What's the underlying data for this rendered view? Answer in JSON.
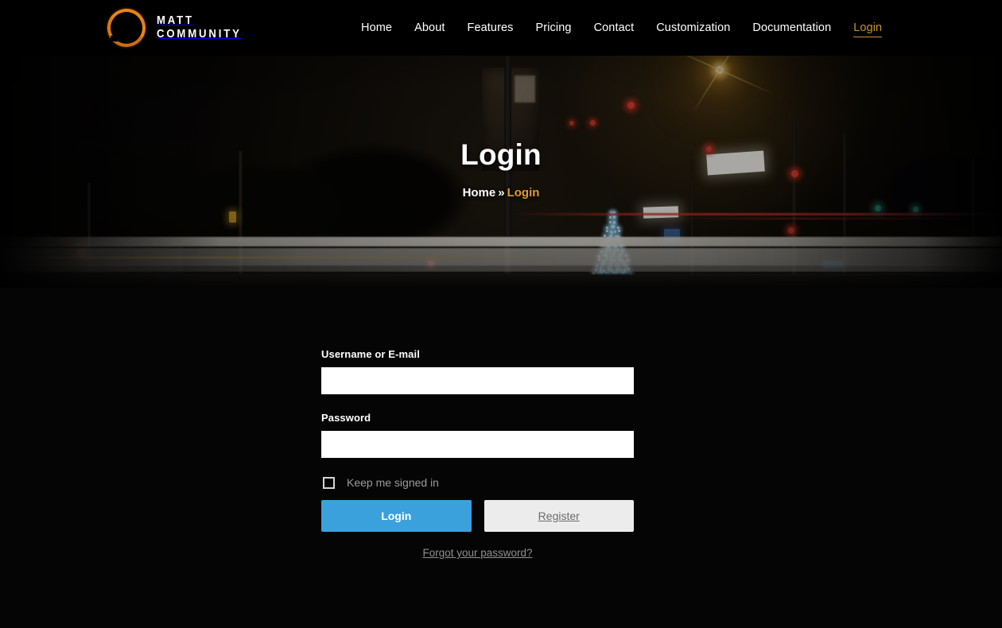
{
  "brand": {
    "line1": "MATT",
    "line2": "COMMUNITY",
    "mark_icon": "circle-ring-logo-icon",
    "accent_color": "#e8821a"
  },
  "nav": {
    "items": [
      {
        "label": "Home",
        "active": false
      },
      {
        "label": "About",
        "active": false
      },
      {
        "label": "Features",
        "active": false
      },
      {
        "label": "Pricing",
        "active": false
      },
      {
        "label": "Contact",
        "active": false
      },
      {
        "label": "Customization",
        "active": false
      },
      {
        "label": "Documentation",
        "active": false
      },
      {
        "label": "Login",
        "active": true
      }
    ],
    "active_color": "#c8922e"
  },
  "hero": {
    "title": "Login",
    "breadcrumb": {
      "home": "Home",
      "separator": "»",
      "current": "Login",
      "current_color": "#e09a2a"
    }
  },
  "form": {
    "username_label": "Username or E-mail",
    "username_value": "",
    "username_placeholder": "",
    "password_label": "Password",
    "password_value": "",
    "password_placeholder": "",
    "keep_signed_in_label": "Keep me signed in",
    "keep_signed_in_checked": false,
    "login_button": "Login",
    "login_button_color": "#3ba1dd",
    "register_button": "Register",
    "register_button_color": "#ececec",
    "forgot_link": "Forgot your password?"
  }
}
